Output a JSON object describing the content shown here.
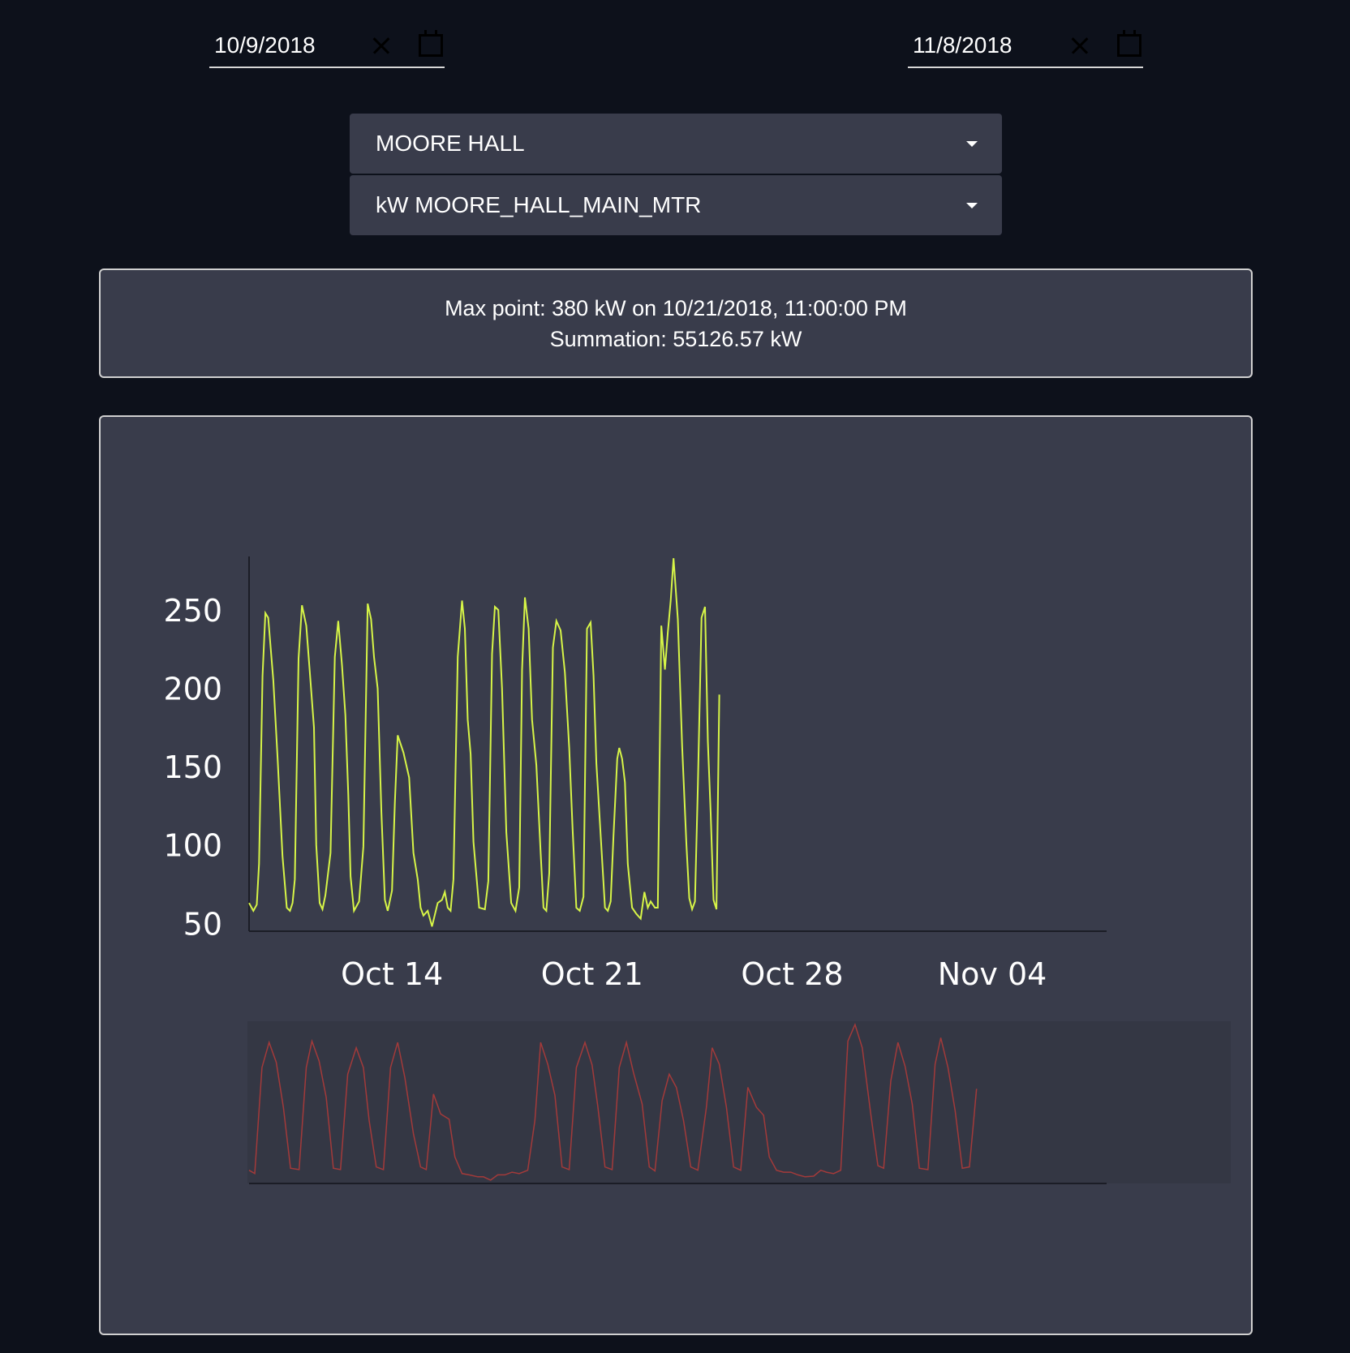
{
  "start_date": {
    "value": "10/9/2018"
  },
  "end_date": {
    "value": "11/8/2018"
  },
  "building_select": {
    "selected": "MOORE HALL"
  },
  "meter_select": {
    "selected": "kW MOORE_HALL_MAIN_MTR"
  },
  "info": {
    "max_point": "Max point: 380 kW on 10/21/2018, 11:00:00 PM",
    "summation": "Summation: 55126.57 kW"
  },
  "colors": {
    "page_bg": "#0d111b",
    "panel_bg": "#393c4b",
    "main_series": "#d7f547",
    "overview_series": "#a33a3a"
  },
  "chart_data": {
    "type": "line",
    "title": "",
    "xlabel": "",
    "ylabel": "",
    "y_ticks": [
      50,
      100,
      150,
      200,
      250
    ],
    "x_ticks": [
      "Oct 14",
      "Oct 21",
      "Oct 28",
      "Nov 04"
    ],
    "ylim": [
      45,
      280
    ],
    "x_range_days": [
      0,
      30
    ],
    "x_tick_days": [
      5,
      12,
      19,
      26
    ],
    "series": [
      {
        "name": "",
        "days": [
          0.0,
          0.15,
          0.27,
          0.35,
          0.47,
          0.57,
          0.67,
          0.85,
          1.0,
          1.17,
          1.32,
          1.43,
          1.52,
          1.6,
          1.73,
          1.85,
          2.0,
          2.15,
          2.27,
          2.35,
          2.47,
          2.57,
          2.67,
          2.85,
          3.0,
          3.12,
          3.25,
          3.37,
          3.47,
          3.55,
          3.67,
          3.85,
          4.0,
          4.15,
          4.27,
          4.37,
          4.5,
          4.63,
          4.75,
          4.85,
          5.0,
          5.1,
          5.2,
          5.4,
          5.6,
          5.75,
          5.9,
          6.0,
          6.1,
          6.25,
          6.4,
          6.6,
          6.75,
          6.85,
          6.95,
          7.05,
          7.15,
          7.3,
          7.45,
          7.55,
          7.65,
          7.75,
          7.85,
          8.05,
          8.25,
          8.37,
          8.5,
          8.6,
          8.72,
          8.85,
          9.0,
          9.17,
          9.32,
          9.45,
          9.55,
          9.65,
          9.78,
          9.9,
          10.05,
          10.2,
          10.3,
          10.4,
          10.5,
          10.63,
          10.75,
          10.9,
          11.05,
          11.2,
          11.32,
          11.45,
          11.57,
          11.7,
          11.82,
          11.95,
          12.05,
          12.15,
          12.3,
          12.45,
          12.55,
          12.65,
          12.75,
          12.88,
          12.95,
          13.05,
          13.15,
          13.25,
          13.4,
          13.55,
          13.7,
          13.83,
          13.95,
          14.05,
          14.2,
          14.3,
          14.42,
          14.55,
          14.65,
          14.75,
          14.85,
          15.0,
          15.15,
          15.3,
          15.4,
          15.5,
          15.6,
          15.7,
          15.83,
          15.95,
          16.05,
          16.15,
          16.25,
          16.35,
          16.45
        ],
        "values": [
          63,
          58,
          62,
          88,
          208,
          248,
          245,
          205,
          155,
          93,
          60,
          58,
          63,
          78,
          219,
          253,
          240,
          204,
          175,
          100,
          63,
          59,
          68,
          95,
          220,
          243,
          215,
          183,
          132,
          80,
          58,
          64,
          99,
          254,
          244,
          220,
          200,
          121,
          65,
          58,
          71,
          127,
          170,
          159,
          143,
          95,
          78,
          60,
          55,
          58,
          48,
          63,
          65,
          70,
          60,
          58,
          78,
          220,
          256,
          238,
          180,
          158,
          102,
          60,
          59,
          77,
          222,
          252,
          250,
          200,
          108,
          63,
          58,
          73,
          212,
          258,
          238,
          180,
          151,
          95,
          60,
          58,
          82,
          226,
          243,
          237,
          210,
          162,
          110,
          60,
          58,
          67,
          238,
          242,
          208,
          152,
          106,
          60,
          58,
          64,
          106,
          155,
          162,
          155,
          140,
          88,
          60,
          56,
          53,
          70,
          60,
          64,
          60,
          60,
          240,
          212,
          236,
          256,
          283,
          244,
          163,
          100,
          66,
          59,
          64,
          138,
          245,
          252,
          166,
          120,
          65,
          59,
          196,
          242,
          282,
          253,
          235,
          145,
          68,
          63,
          62,
          205,
          222
        ]
      }
    ],
    "overview_series": [
      {
        "name": "",
        "days": [
          0.0,
          0.2,
          0.45,
          0.7,
          0.95,
          1.2,
          1.45,
          1.75,
          2.0,
          2.2,
          2.45,
          2.7,
          2.95,
          3.2,
          3.45,
          3.75,
          4.0,
          4.2,
          4.45,
          4.7,
          4.95,
          5.2,
          5.45,
          5.75,
          6.0,
          6.2,
          6.45,
          6.7,
          7.0,
          7.2,
          7.45,
          7.7,
          8.0,
          8.2,
          8.45,
          8.7,
          8.95,
          9.2,
          9.45,
          9.75,
          10.0,
          10.2,
          10.45,
          10.7,
          10.95,
          11.2,
          11.45,
          11.75,
          12.0,
          12.2,
          12.45,
          12.7,
          12.95,
          13.2,
          13.45,
          13.75,
          14.0,
          14.2,
          14.45,
          14.7,
          14.95,
          15.2,
          15.45,
          15.7,
          16.0,
          16.2,
          16.45,
          16.7,
          16.95,
          17.2,
          17.45,
          17.75,
          18.0,
          18.2,
          18.45,
          18.7,
          18.95,
          19.2,
          19.45,
          19.75,
          20.0,
          20.2,
          20.45,
          20.7,
          20.95,
          21.2,
          21.45,
          21.75,
          22.0,
          22.2,
          22.45,
          22.7,
          22.95,
          23.2,
          23.45,
          23.75,
          24.0,
          24.2,
          24.45,
          24.7,
          24.95,
          25.2,
          25.45,
          25.75,
          26.0,
          26.2,
          26.45,
          26.7,
          26.95,
          27.2,
          27.45,
          27.75,
          28.0,
          28.2,
          28.45,
          28.7,
          28.95,
          29.2,
          29.45,
          29.75,
          29.99
        ],
        "values": [
          65,
          60,
          220,
          258,
          228,
          160,
          68,
          66,
          220,
          260,
          230,
          175,
          68,
          66,
          210,
          250,
          220,
          140,
          70,
          66,
          220,
          258,
          205,
          120,
          70,
          66,
          180,
          150,
          142,
          85,
          60,
          58,
          55,
          55,
          50,
          58,
          58,
          62,
          60,
          65,
          140,
          258,
          225,
          178,
          70,
          66,
          220,
          258,
          224,
          162,
          70,
          66,
          220,
          258,
          212,
          165,
          70,
          64,
          170,
          210,
          190,
          140,
          70,
          65,
          160,
          250,
          225,
          160,
          70,
          65,
          190,
          160,
          148,
          85,
          65,
          62,
          62,
          58,
          55,
          56,
          65,
          62,
          60,
          65,
          260,
          285,
          250,
          150,
          72,
          68,
          200,
          258,
          222,
          165,
          68,
          66,
          225,
          265,
          220,
          155,
          68,
          70,
          188
        ]
      }
    ]
  }
}
